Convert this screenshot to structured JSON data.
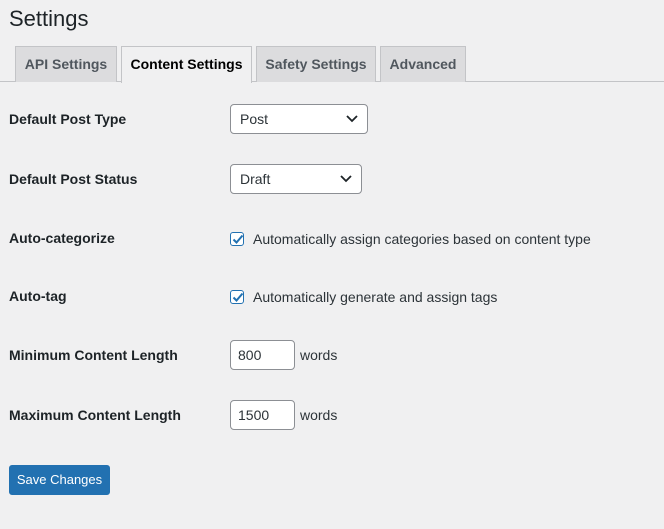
{
  "page": {
    "title": "Settings"
  },
  "tabs": [
    {
      "label": "API Settings",
      "active": false
    },
    {
      "label": "Content Settings",
      "active": true
    },
    {
      "label": "Safety Settings",
      "active": false
    },
    {
      "label": "Advanced",
      "active": false
    }
  ],
  "form": {
    "default_post_type": {
      "label": "Default Post Type",
      "value": "Post",
      "icon": "chevron-down-icon"
    },
    "default_post_status": {
      "label": "Default Post Status",
      "value": "Draft",
      "icon": "chevron-down-icon"
    },
    "auto_categorize": {
      "label": "Auto-categorize",
      "checked": true,
      "description": "Automatically assign categories based on content type"
    },
    "auto_tag": {
      "label": "Auto-tag",
      "checked": true,
      "description": "Automatically generate and assign tags"
    },
    "min_content_length": {
      "label": "Minimum Content Length",
      "value": "800",
      "suffix": "words"
    },
    "max_content_length": {
      "label": "Maximum Content Length",
      "value": "1500",
      "suffix": "words"
    }
  },
  "actions": {
    "save_label": "Save Changes"
  },
  "colors": {
    "primary": "#2271b1",
    "background": "#f0f0f1",
    "tab_inactive": "#dcdcde",
    "border": "#8c8f94"
  }
}
